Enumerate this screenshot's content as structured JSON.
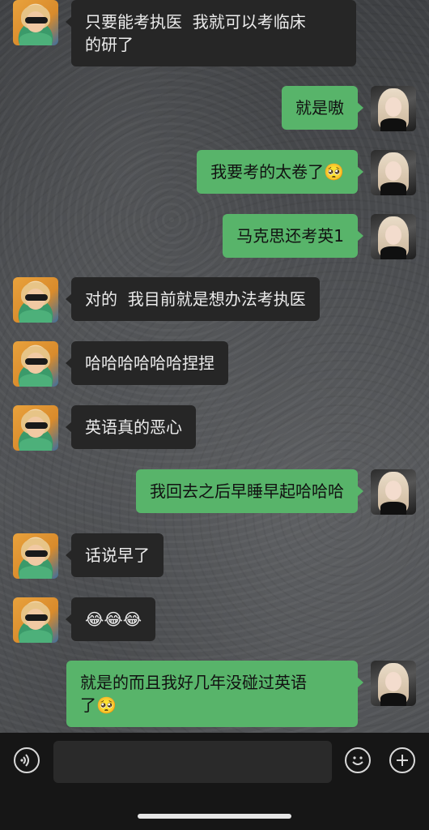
{
  "messages": [
    {
      "side": "left",
      "text": "只要能考执医  我就可以考临床\n的研了"
    },
    {
      "side": "right",
      "text": "就是嗷"
    },
    {
      "side": "right",
      "text": "我要考的太卷了🥺"
    },
    {
      "side": "right",
      "text": "马克思还考英1"
    },
    {
      "side": "left",
      "text": "对的  我目前就是想办法考执医"
    },
    {
      "side": "left",
      "text": "哈哈哈哈哈哈捏捏"
    },
    {
      "side": "left",
      "text": "英语真的恶心"
    },
    {
      "side": "right",
      "text": "我回去之后早睡早起哈哈哈"
    },
    {
      "side": "left",
      "text": "话说早了"
    },
    {
      "side": "left",
      "text": "😂😂😂"
    },
    {
      "side": "right",
      "text": "就是的而且我好几年没碰过英语\n了🥺"
    }
  ],
  "composer": {
    "input_value": "",
    "voice_icon": "voice-icon",
    "emoji_icon": "emoji-icon",
    "plus_icon": "plus-icon"
  },
  "colors": {
    "incoming_bubble": "#262626",
    "outgoing_bubble": "#58b46a",
    "composer_bg": "#161616"
  }
}
